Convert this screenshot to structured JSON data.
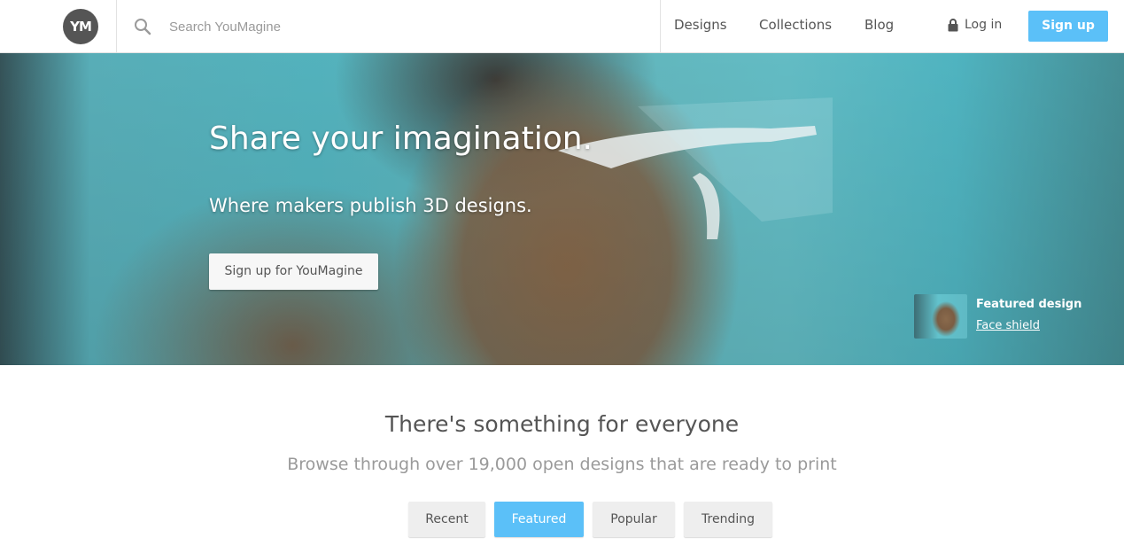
{
  "colors": {
    "accent": "#5bc0f8",
    "text": "#555555",
    "muted": "#9a9a9a",
    "tab_bg": "#eeeeee"
  },
  "header": {
    "logo_text": "YM",
    "search": {
      "placeholder": "Search YouMagine",
      "value": "",
      "icon": "search-icon"
    },
    "nav": [
      {
        "label": "Designs"
      },
      {
        "label": "Collections"
      },
      {
        "label": "Blog"
      }
    ],
    "login_label": "Log in",
    "login_icon": "lock-icon",
    "signup_label": "Sign up"
  },
  "hero": {
    "title": "Share your imagination.",
    "subtitle": "Where makers publish 3D designs.",
    "cta_label": "Sign up for YouMagine",
    "featured": {
      "heading": "Featured design",
      "link": "Face shield"
    }
  },
  "main": {
    "title": "There's something for everyone",
    "subtitle": "Browse through over 19,000 open designs that are ready to print",
    "tabs": [
      {
        "label": "Recent",
        "active": false
      },
      {
        "label": "Featured",
        "active": true
      },
      {
        "label": "Popular",
        "active": false
      },
      {
        "label": "Trending",
        "active": false
      }
    ]
  }
}
